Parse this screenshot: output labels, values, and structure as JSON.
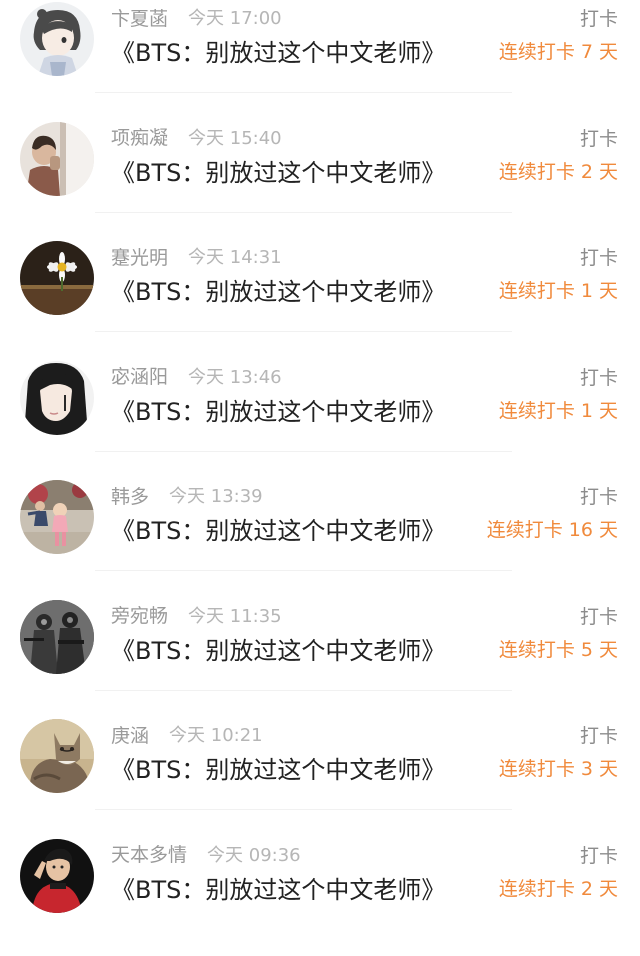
{
  "colors": {
    "name": "#9a9a9a",
    "time": "#b6b6b6",
    "title": "#222222",
    "type": "#8c8c8c",
    "streak": "#f08a3c"
  },
  "feed": {
    "items": [
      {
        "name": "卞夏菡",
        "time": "今天 17:00",
        "title": "《BTS：别放过这个中文老师》",
        "type": "打卡",
        "streak": "连续打卡 7 天"
      },
      {
        "name": "项痴凝",
        "time": "今天 15:40",
        "title": "《BTS：别放过这个中文老师》",
        "type": "打卡",
        "streak": "连续打卡 2 天"
      },
      {
        "name": "蹇光明",
        "time": "今天 14:31",
        "title": "《BTS：别放过这个中文老师》",
        "type": "打卡",
        "streak": "连续打卡 1 天"
      },
      {
        "name": "宓涵阳",
        "time": "今天 13:46",
        "title": "《BTS：别放过这个中文老师》",
        "type": "打卡",
        "streak": "连续打卡 1 天"
      },
      {
        "name": "韩多",
        "time": "今天 13:39",
        "title": "《BTS：别放过这个中文老师》",
        "type": "打卡",
        "streak": "连续打卡 16 天"
      },
      {
        "name": "旁宛畅",
        "time": "今天 11:35",
        "title": "《BTS：别放过这个中文老师》",
        "type": "打卡",
        "streak": "连续打卡 5 天"
      },
      {
        "name": "庚涵",
        "time": "今天 10:21",
        "title": "《BTS：别放过这个中文老师》",
        "type": "打卡",
        "streak": "连续打卡 3 天"
      },
      {
        "name": "天本多情",
        "time": "今天 09:36",
        "title": "《BTS：别放过这个中文老师》",
        "type": "打卡",
        "streak": "连续打卡 2 天"
      }
    ]
  }
}
